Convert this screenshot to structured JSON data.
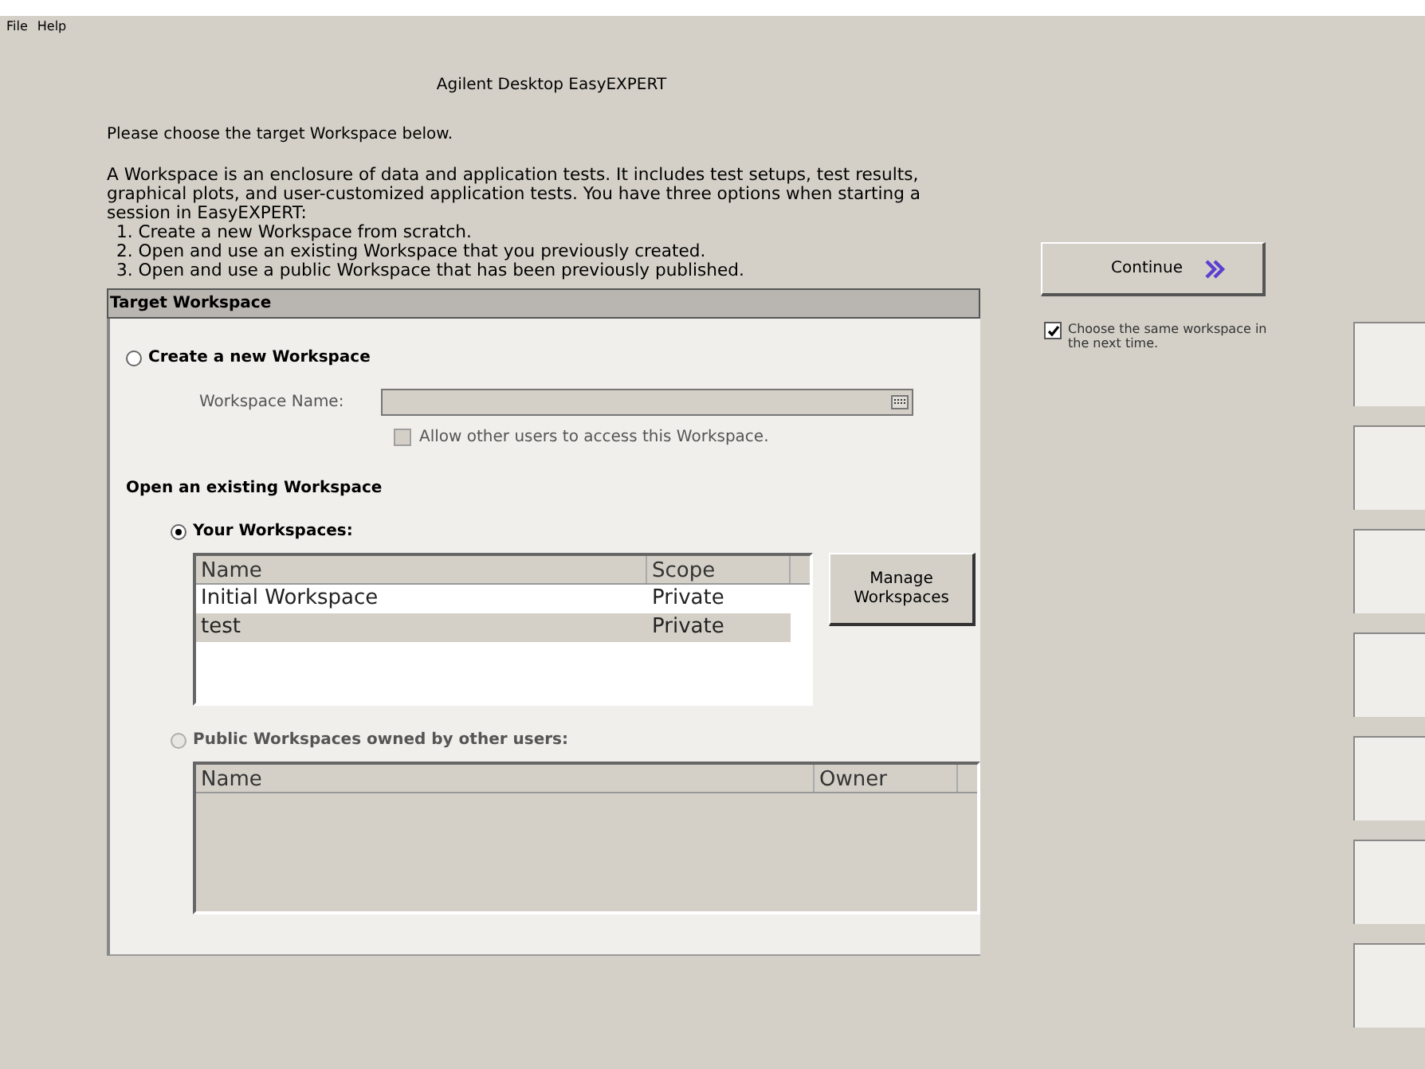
{
  "menu": [
    {
      "label": "File"
    },
    {
      "label": "Help"
    }
  ],
  "title": "Agilent Desktop EasyEXPERT",
  "instruction": "Please choose the target Workspace below.",
  "description": "A Workspace is an enclosure of data and application tests. It includes test setups, test results, graphical plots, and user-customized application tests. You have three options when starting a session in EasyEXPERT:",
  "options": [
    "1. Create a new Workspace from scratch.",
    "2. Open and use an existing Workspace that you previously created.",
    "3. Open and use a public Workspace that has been previously published."
  ],
  "continue_button": {
    "label": "Continue"
  },
  "remember_checkbox": {
    "label": "Choose the same workspace in the next time.",
    "checked": true
  },
  "panel": {
    "title": "Target Workspace",
    "create": {
      "label": "Create a new Workspace",
      "selected": false,
      "name_field": {
        "label": "Workspace Name:",
        "disabled": true
      },
      "allow_checkbox": {
        "label": "Allow other users to access this Workspace.",
        "checked": false,
        "disabled": true
      }
    },
    "open_heading": "Open an existing Workspace",
    "yours": {
      "label": "Your Workspaces:",
      "selected": true,
      "disabled": false,
      "table": {
        "columns": [
          "Name",
          "Scope"
        ],
        "rows": [
          {
            "cells": [
              "Initial Workspace",
              "Private"
            ],
            "selected": false
          },
          {
            "cells": [
              "test",
              "Private"
            ],
            "selected": true
          }
        ]
      },
      "manage_button": {
        "label": "Manage Workspaces"
      }
    },
    "public": {
      "label": "Public Workspaces owned by other users:",
      "selected": false,
      "disabled": true,
      "table": {
        "columns": [
          "Name",
          "Owner"
        ]
      }
    }
  }
}
